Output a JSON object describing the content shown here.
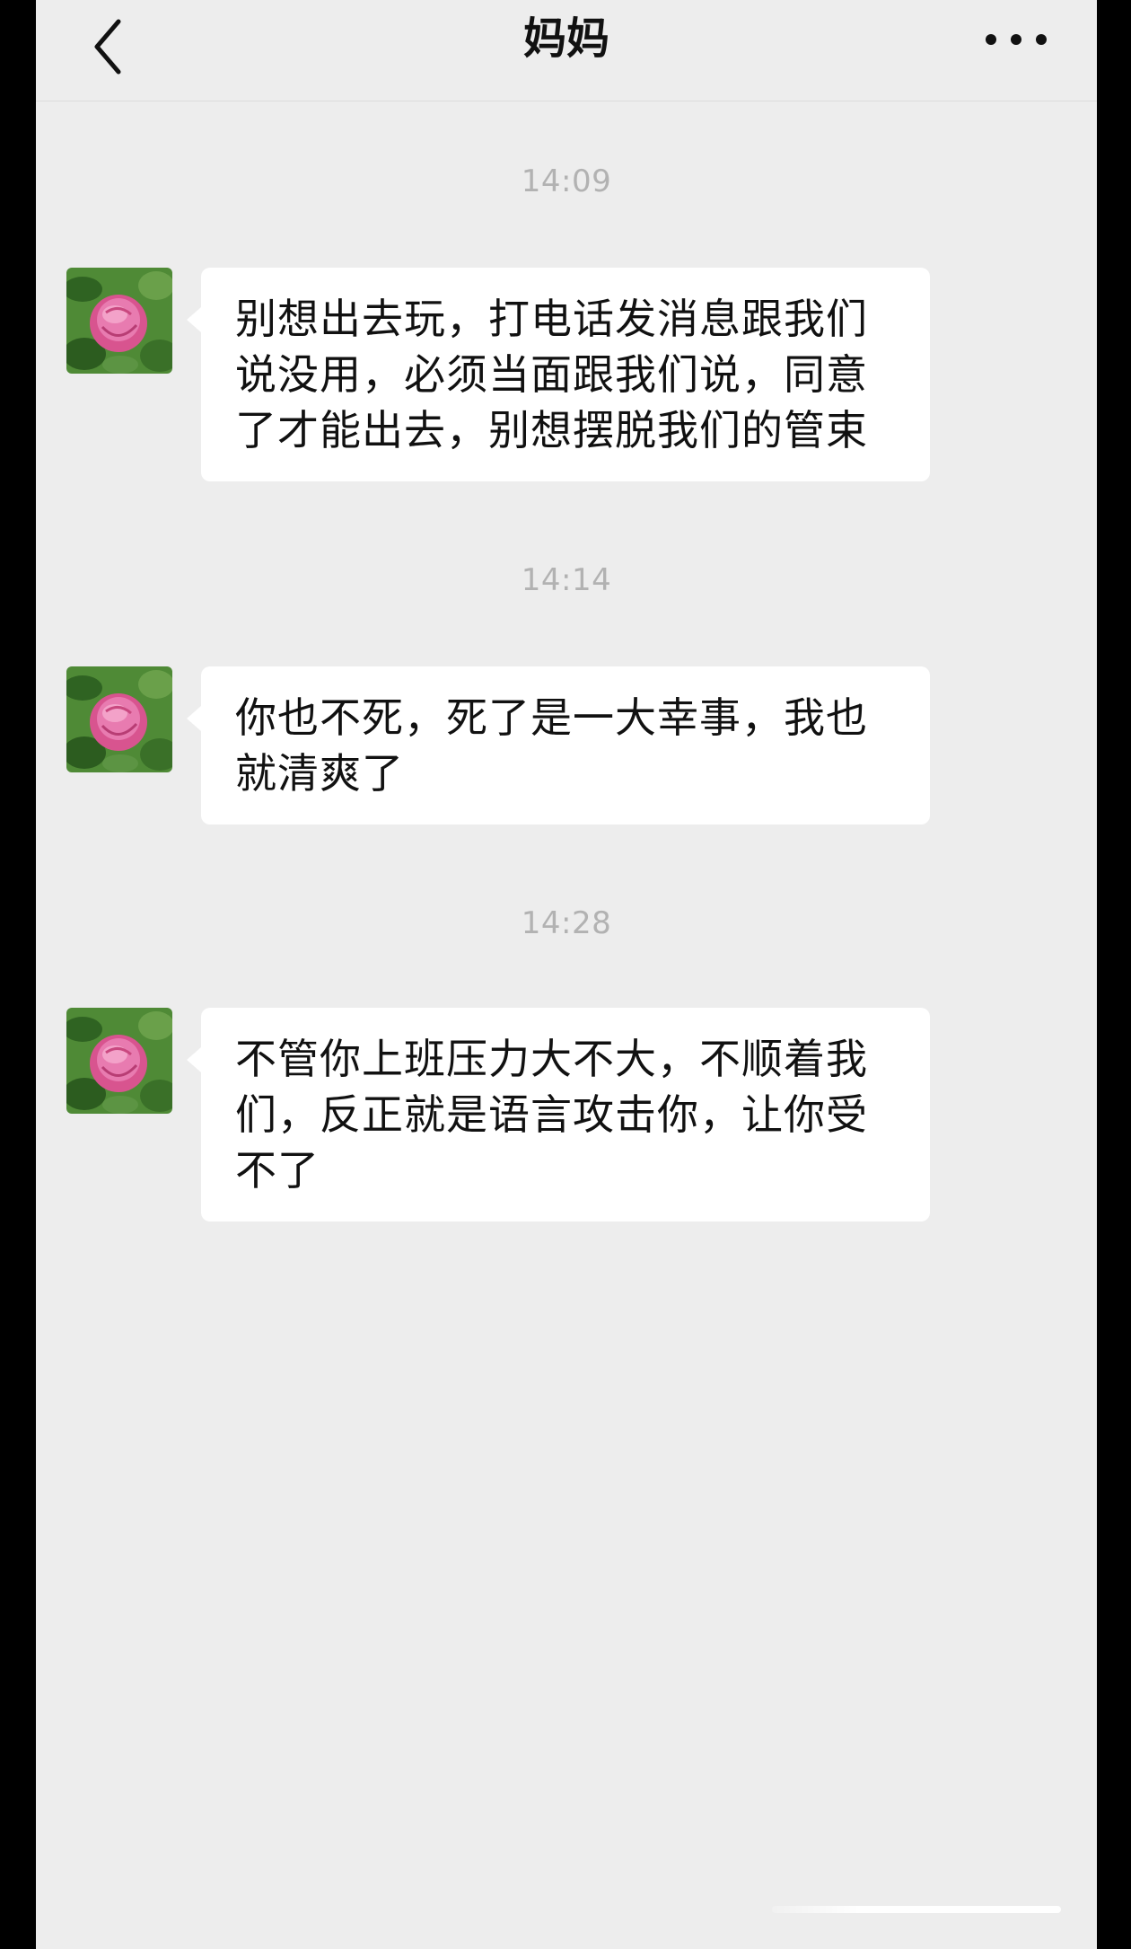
{
  "header": {
    "title": "妈妈",
    "back_icon": "chevron-left-icon",
    "more_icon": "more-horizontal-icon"
  },
  "messages": [
    {
      "time": "14:09",
      "sender": "mom",
      "avatar_icon": "pink-rose-avatar",
      "text": "别想出去玩，打电话发消息跟我们说没用，必须当面跟我们说，同意了才能出去，别想摆脱我们的管束"
    },
    {
      "time": "14:14",
      "sender": "mom",
      "avatar_icon": "pink-rose-avatar",
      "text": "你也不死，死了是一大幸事，我也就清爽了"
    },
    {
      "time": "14:28",
      "sender": "mom",
      "avatar_icon": "pink-rose-avatar",
      "text": "不管你上班压力大不大，不顺着我们，反正就是语言攻击你，让你受不了"
    }
  ],
  "colors": {
    "background": "#ededed",
    "bubble": "#ffffff",
    "timestamp": "#b2b2b2",
    "text": "#111111",
    "rose": "#e0609a",
    "leaves": "#3f7a2a"
  }
}
